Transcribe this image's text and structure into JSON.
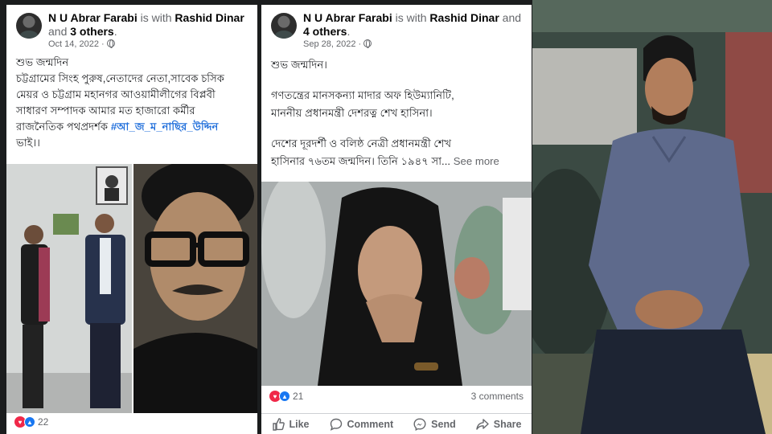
{
  "post1": {
    "author": "N U Abrar Farabi",
    "with_text": "is with",
    "tagged": "Rashid Dinar",
    "and_text": "and",
    "others": "3 others",
    "date": "Oct 14, 2022",
    "text_lines": [
      "শুভ জন্মদিন",
      "চট্টগ্রামের সিংহ পুরুষ,নেতাদের নেতা,সাবেক চসিক",
      "মেয়র ও চট্টগ্রাম মহানগর আওয়ামীলীগের বিপ্লবী",
      "সাধারণ সম্পাদক আমার মত হাজারো কর্মীর",
      "রাজনৈতিক পথপ্রদর্শক"
    ],
    "hashtag": "#আ_জ_ম_নাছির_উদ্দিন",
    "suffix": "ভাই।।",
    "reactions_count": "22"
  },
  "post2": {
    "author": "N U Abrar Farabi",
    "with_text": "is with",
    "tagged": "Rashid Dinar",
    "and_text": "and",
    "others": "4 others",
    "date": "Sep 28, 2022",
    "text_lines": [
      "শুভ জন্মদিন।",
      "গণতন্ত্রের মানসকন্যা মাদার অফ হিউম্যানিটি,",
      "মাননীয় প্রধানমন্ত্রী দেশরত্ন শেখ হাসিনা।",
      "দেশের দূরদর্শী ও বলিষ্ঠ নেত্রী  প্রধানমন্ত্রী শেখ",
      "হাসিনার ৭৬তম জন্মদিন। তিনি ১৯৪৭ সা..."
    ],
    "see_more": "See more",
    "reactions_count": "21",
    "comments": "3 comments",
    "actions": [
      "Like",
      "Comment",
      "Send",
      "Share"
    ]
  },
  "icons": {
    "privacy": "globe-icon",
    "reaction_love": "love-reaction-icon",
    "reaction_like": "like-reaction-icon"
  },
  "colors": {
    "hashtag": "#216fdb",
    "like_blue": "#1877f2",
    "love_red": "#f02849"
  }
}
